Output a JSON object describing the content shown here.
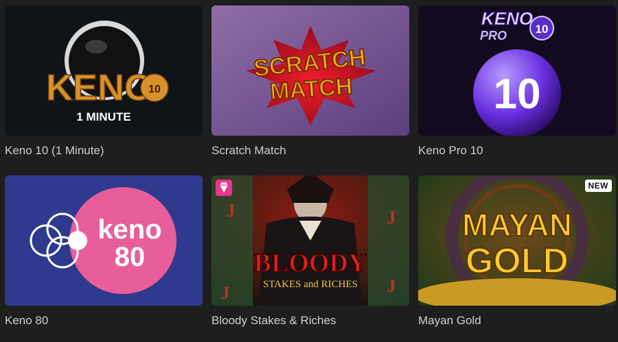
{
  "games": [
    {
      "title": "Keno 10 (1 Minute)",
      "art_main": "KENO",
      "art_num": "10",
      "art_sub": "1 MINUTE"
    },
    {
      "title": "Scratch Match",
      "art_line1": "SCRATCH",
      "art_line2": "MATCH"
    },
    {
      "title": "Keno Pro 10",
      "art_brand1": "KENO",
      "art_brand2": "PRO",
      "art_num": "10",
      "art_ball": "10"
    },
    {
      "title": "Keno 80",
      "art_word": "keno",
      "art_num": "80"
    },
    {
      "title": "Bloody Stakes & Riches",
      "art_main": "BLOODY",
      "art_sub": "STAKES and RICHES",
      "card_letter": "J",
      "badge_icon": "diamond-icon"
    },
    {
      "title": "Mayan Gold",
      "art_line1": "MAYAN",
      "art_line2": "GOLD",
      "badge": "NEW"
    }
  ]
}
